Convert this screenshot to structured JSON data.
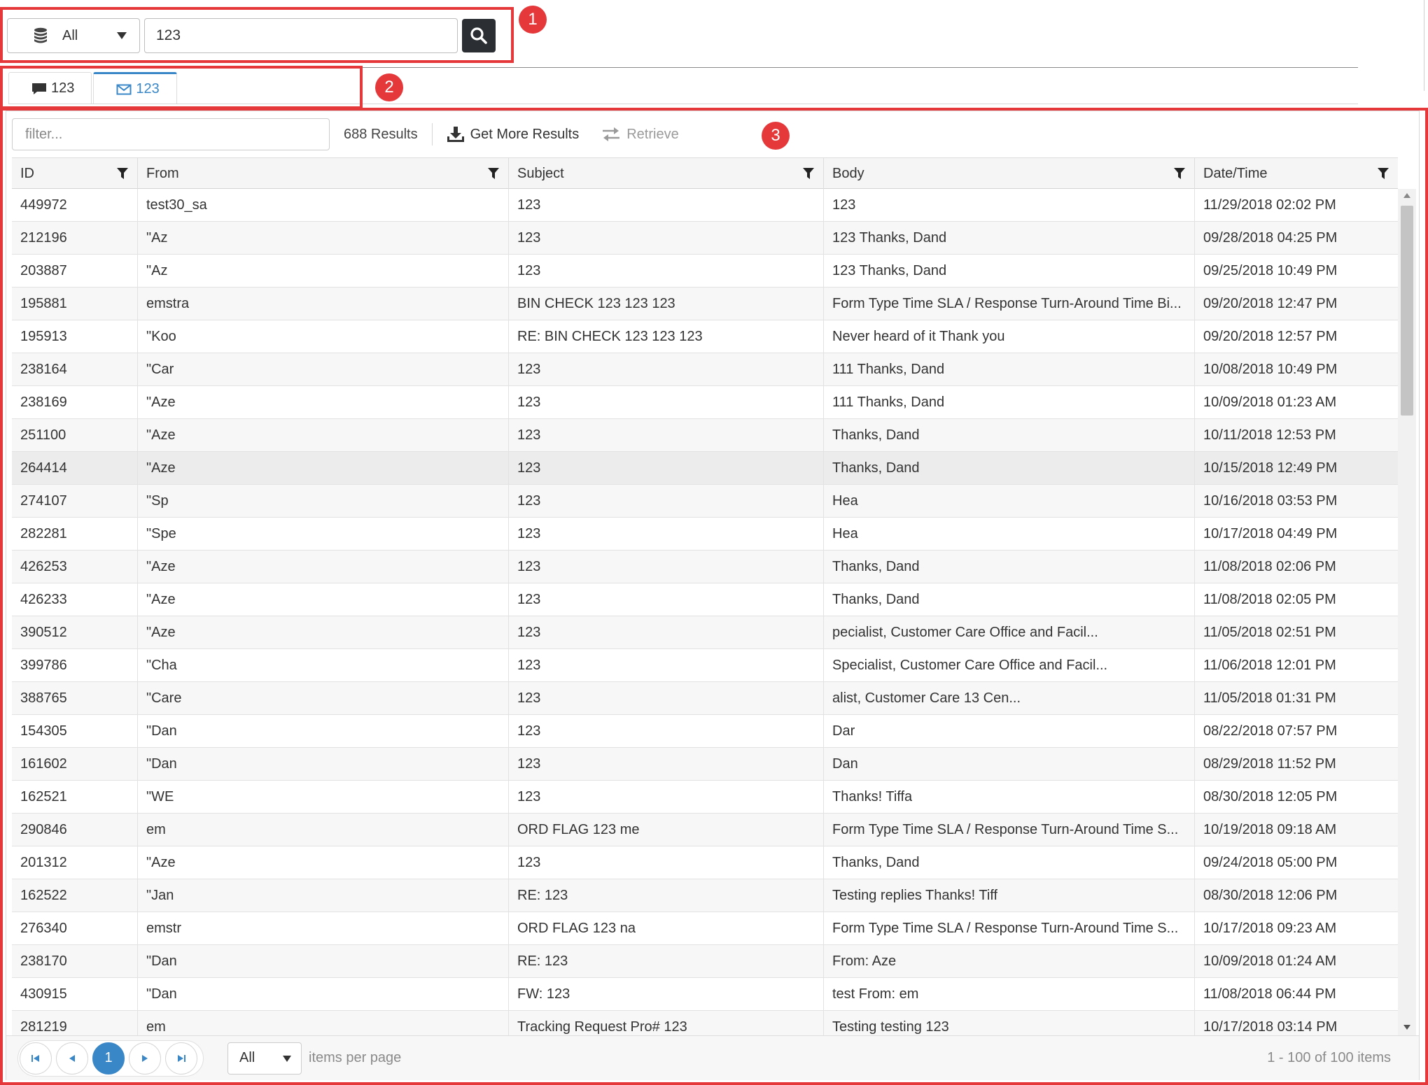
{
  "search": {
    "database_select": "All",
    "query": "123"
  },
  "tabs": [
    {
      "label": "123",
      "icon": "chat-icon"
    },
    {
      "label": "123",
      "icon": "envelope-icon"
    }
  ],
  "toolbar": {
    "filter_placeholder": "filter...",
    "results_count": "688 Results",
    "get_more_label": "Get More Results",
    "retrieve_label": "Retrieve"
  },
  "columns": [
    "ID",
    "From",
    "Subject",
    "Body",
    "Date/Time"
  ],
  "rows": [
    {
      "id": "449972",
      "from": "test30_sa",
      "subject": "123",
      "body": "123",
      "date": "11/29/2018 02:02 PM"
    },
    {
      "id": "212196",
      "from": "\"Az",
      "subject": "123",
      "body": "123 Thanks, Dand",
      "date": "09/28/2018 04:25 PM"
    },
    {
      "id": "203887",
      "from": "\"Az",
      "subject": "123",
      "body": "123 Thanks, Dand",
      "date": "09/25/2018 10:49 PM"
    },
    {
      "id": "195881",
      "from": "emstra",
      "subject": "BIN CHECK 123 123 123",
      "body": "Form Type Time SLA / Response Turn-Around Time Bi...",
      "date": "09/20/2018 12:47 PM"
    },
    {
      "id": "195913",
      "from": "\"Koo",
      "subject": "RE: BIN CHECK 123 123 123",
      "body": "Never heard of it Thank you",
      "date": "09/20/2018 12:57 PM"
    },
    {
      "id": "238164",
      "from": "\"Car",
      "subject": "123",
      "body": "111 Thanks, Dand",
      "date": "10/08/2018 10:49 PM"
    },
    {
      "id": "238169",
      "from": "\"Aze",
      "subject": "123",
      "body": "111 Thanks, Dand",
      "date": "10/09/2018 01:23 AM"
    },
    {
      "id": "251100",
      "from": "\"Aze",
      "subject": "123",
      "body": "Thanks, Dand",
      "date": "10/11/2018 12:53 PM"
    },
    {
      "id": "264414",
      "from": "\"Aze",
      "subject": "123",
      "body": "Thanks, Dand",
      "date": "10/15/2018 12:49 PM"
    },
    {
      "id": "274107",
      "from": "\"Sp",
      "subject": "123",
      "body": "Hea",
      "date": "10/16/2018 03:53 PM"
    },
    {
      "id": "282281",
      "from": "\"Spe",
      "subject": "123",
      "body": "Hea",
      "date": "10/17/2018 04:49 PM"
    },
    {
      "id": "426253",
      "from": "\"Aze",
      "subject": "123",
      "body": "Thanks, Dand",
      "date": "11/08/2018 02:06 PM"
    },
    {
      "id": "426233",
      "from": "\"Aze",
      "subject": "123",
      "body": "Thanks, Dand",
      "date": "11/08/2018 02:05 PM"
    },
    {
      "id": "390512",
      "from": "\"Aze",
      "subject": "123",
      "body": "pecialist, Customer Care Office and Facil...",
      "date": "11/05/2018 02:51 PM"
    },
    {
      "id": "399786",
      "from": "\"Cha",
      "subject": "123",
      "body": "Specialist, Customer Care Office and Facil...",
      "date": "11/06/2018 12:01 PM"
    },
    {
      "id": "388765",
      "from": "\"Care",
      "subject": "123",
      "body": "alist, Customer Care 13 Cen...",
      "date": "11/05/2018 01:31 PM"
    },
    {
      "id": "154305",
      "from": "\"Dan",
      "subject": "123",
      "body": "Dar",
      "date": "08/22/2018 07:57 PM"
    },
    {
      "id": "161602",
      "from": "\"Dan",
      "subject": "123",
      "body": "Dan",
      "date": "08/29/2018 11:52 PM"
    },
    {
      "id": "162521",
      "from": "\"WE",
      "subject": "123",
      "body": "Thanks! Tiffa",
      "date": "08/30/2018 12:05 PM"
    },
    {
      "id": "290846",
      "from": "em",
      "subject": "ORD FLAG 123 me",
      "body": "Form Type Time SLA / Response Turn-Around Time S...",
      "date": "10/19/2018 09:18 AM"
    },
    {
      "id": "201312",
      "from": "\"Aze",
      "subject": "123",
      "body": "Thanks, Dand",
      "date": "09/24/2018 05:00 PM"
    },
    {
      "id": "162522",
      "from": "\"Jan",
      "subject": "RE: 123",
      "body": "Testing replies Thanks! Tiff",
      "date": "08/30/2018 12:06 PM"
    },
    {
      "id": "276340",
      "from": "emstr",
      "subject": "ORD FLAG 123 na",
      "body": "Form Type Time SLA / Response Turn-Around Time S...",
      "date": "10/17/2018 09:23 AM"
    },
    {
      "id": "238170",
      "from": "\"Dan",
      "subject": "RE: 123",
      "body": "From: Aze",
      "date": "10/09/2018 01:24 AM"
    },
    {
      "id": "430915",
      "from": "\"Dan",
      "subject": "FW: 123",
      "body": "test From: em",
      "date": "11/08/2018 06:44 PM"
    },
    {
      "id": "281219",
      "from": "em",
      "subject": "Tracking Request Pro# 123",
      "body": "Testing testing 123",
      "date": "10/17/2018 03:14 PM"
    }
  ],
  "pager": {
    "current_page": "1",
    "page_size": "All",
    "page_size_label": "items per page",
    "info": "1 - 100 of 100 items"
  },
  "callouts": [
    "1",
    "2",
    "3"
  ],
  "colors": {
    "callout": "#e5383b",
    "accent": "#3a87c8"
  }
}
